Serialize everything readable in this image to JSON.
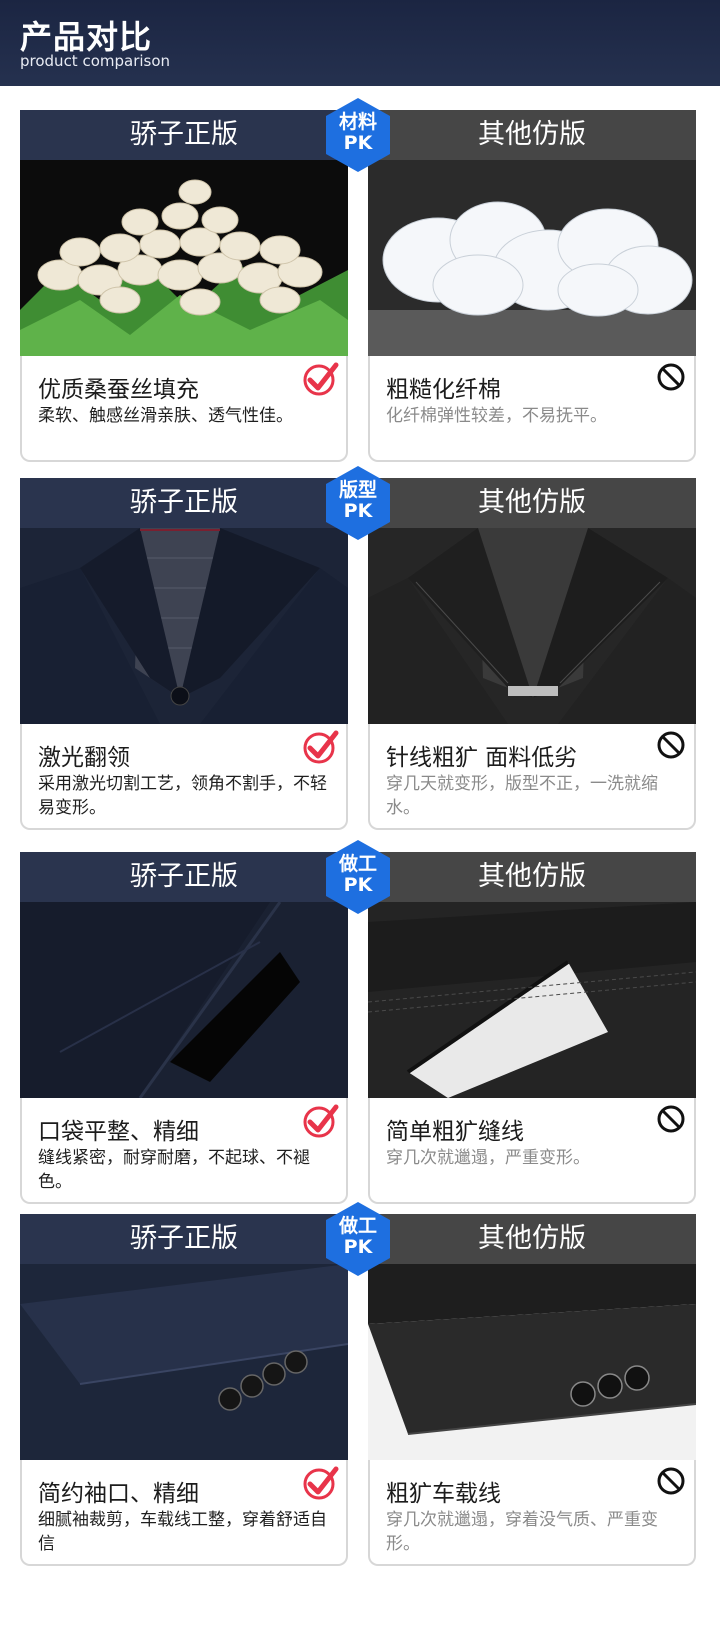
{
  "header": {
    "title": "产品对比",
    "subtitle": "product comparison"
  },
  "colors": {
    "badge_blue": "#1e6fe0",
    "genuine_bar": "#2a344e",
    "imitation_bar": "#464646",
    "check_red": "#e8344a"
  },
  "sections": [
    {
      "badge": {
        "line1": "材料",
        "line2": "PK"
      },
      "left": {
        "bar": "骄子正版",
        "title": "优质桑蚕丝填充",
        "desc": "柔软、触感丝滑亲肤、透气性佳。",
        "photo": "silk-cocoons",
        "mark": "check-icon"
      },
      "right": {
        "bar": "其他仿版",
        "title": "粗糙化纤棉",
        "desc": "化纤棉弹性较差，不易抚平。",
        "photo": "synthetic-cotton",
        "mark": "prohibited-icon"
      }
    },
    {
      "badge": {
        "line1": "版型",
        "line2": "PK"
      },
      "left": {
        "bar": "骄子正版",
        "title": "激光翻领",
        "desc": "采用激光切割工艺，领角不割手，不轻易变形。",
        "photo": "navy-collar",
        "mark": "check-icon"
      },
      "right": {
        "bar": "其他仿版",
        "title": "针线粗犷 面料低劣",
        "desc": "穿几天就变形，版型不正，一洗就缩水。",
        "photo": "black-collar",
        "mark": "prohibited-icon"
      }
    },
    {
      "badge": {
        "line1": "做工",
        "line2": "PK"
      },
      "left": {
        "bar": "骄子正版",
        "title": "口袋平整、精细",
        "desc": "缝线紧密，耐穿耐磨，不起球、不褪色。",
        "photo": "navy-pocket-phone",
        "mark": "check-icon"
      },
      "right": {
        "bar": "其他仿版",
        "title": "简单粗犷缝线",
        "desc": "穿几次就邋遢，严重变形。",
        "photo": "black-pocket-phone",
        "mark": "prohibited-icon"
      }
    },
    {
      "badge": {
        "line1": "做工",
        "line2": "PK"
      },
      "left": {
        "bar": "骄子正版",
        "title": "简约袖口、精细",
        "desc": "细腻袖裁剪，车载线工整，穿着舒适自信",
        "photo": "navy-cuff-buttons",
        "mark": "check-icon"
      },
      "right": {
        "bar": "其他仿版",
        "title": "粗犷车载线",
        "desc": "穿几次就邋遢，穿着没气质、严重变形。",
        "photo": "black-cuff-buttons",
        "mark": "prohibited-icon"
      }
    }
  ]
}
